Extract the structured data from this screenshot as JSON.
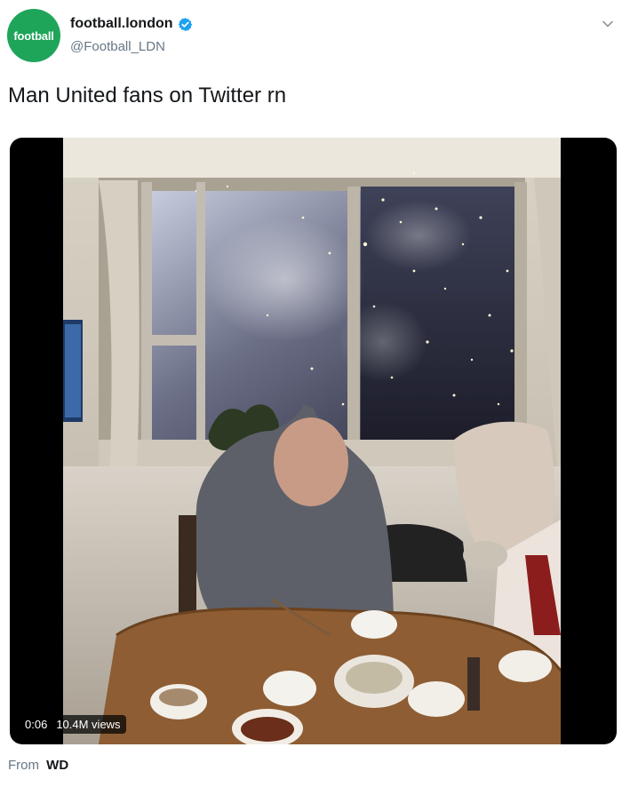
{
  "tweet": {
    "author": {
      "avatar_text": "football",
      "display_name": "football.london",
      "handle": "@Football_LDN",
      "verified": true
    },
    "text": "Man United fans on Twitter rn",
    "menu_icon": "chevron-down-icon"
  },
  "media": {
    "type": "video",
    "overlay": {
      "duration": "0:06",
      "views": "10.4M views"
    }
  },
  "attribution": {
    "label": "From",
    "source": "WD"
  },
  "colors": {
    "brand_green": "#1fa55a",
    "verified_blue": "#1da1f2",
    "secondary_text": "#657786",
    "primary_text": "#14171a"
  }
}
